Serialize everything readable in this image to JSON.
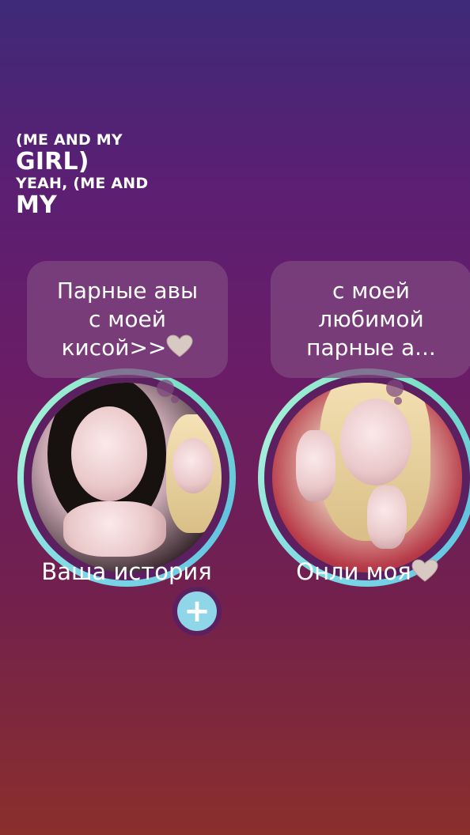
{
  "lyrics": {
    "line1": "(ME AND MY",
    "line2": "GIRL)",
    "line3": "YEAH, (ME AND",
    "line4": "MY"
  },
  "stories": [
    {
      "note": "Парные авы\nс моей\nкисой>>",
      "label": "Ваша история",
      "has_add_button": true,
      "add_symbol": "+"
    },
    {
      "note": "с моей\nлюбимой\nпарные а...",
      "label": "Онли моя",
      "has_add_button": false
    }
  ],
  "colors": {
    "ring_gradient": [
      "#7ad7e6",
      "#a6f0d8",
      "#63c4e0"
    ],
    "add_button": "#8fd7e8",
    "heart": "#d9c9c3"
  },
  "icons": {
    "heart": "white-heart-emoji",
    "add": "plus-icon"
  }
}
